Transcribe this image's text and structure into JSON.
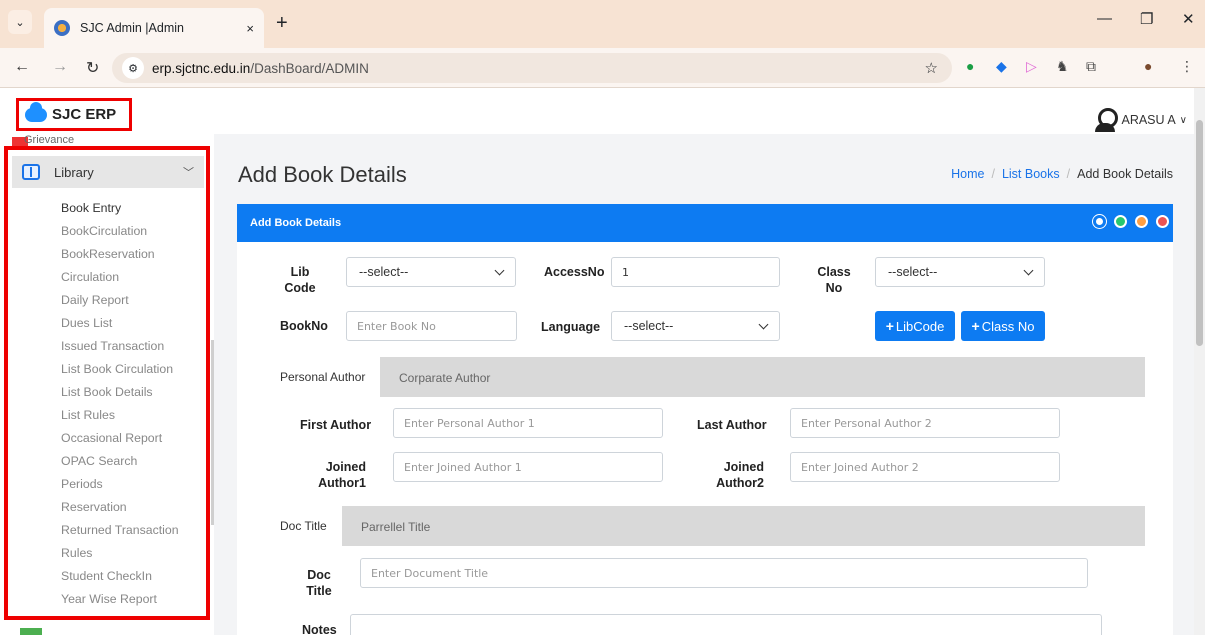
{
  "browser": {
    "tab_title": "SJC Admin |Admin",
    "tab_close": "×",
    "new_tab": "+",
    "url_host": "erp.sjctnc.edu.in",
    "url_path": "/DashBoard/ADMIN",
    "minimize": "—",
    "restore": "❐",
    "close": "✕"
  },
  "header": {
    "brand": "SJC ERP",
    "user": "ARASU A",
    "user_chevron": "∨"
  },
  "sidebar": {
    "grievance": "Grievance",
    "section": "Library",
    "items": [
      "Book Entry",
      "BookCirculation",
      "BookReservation",
      "Circulation",
      "Daily Report",
      "Dues List",
      "Issued Transaction",
      "List Book Circulation",
      "List Book Details",
      "List Rules",
      "Occasional Report",
      "OPAC Search",
      "Periods",
      "Reservation",
      "Returned Transaction",
      "Rules",
      "Student CheckIn",
      "Year Wise Report"
    ]
  },
  "page": {
    "title": "Add Book Details",
    "breadcrumb": {
      "home": "Home",
      "list": "List Books",
      "current": "Add Book Details",
      "sep": "/"
    },
    "card_title": "Add Book Details"
  },
  "form": {
    "lib_code_label1": "Lib",
    "lib_code_label2": "Code",
    "lib_code_value": "--select--",
    "access_no_label": "AccessNo",
    "access_no_value": "1",
    "class_no_label1": "Class",
    "class_no_label2": "No",
    "class_no_value": "--select--",
    "book_no_label": "BookNo",
    "book_no_placeholder": "Enter Book No",
    "language_label": "Language",
    "language_value": "--select--",
    "btn_libcode": "LibCode",
    "btn_classno": "Class No",
    "author_tabs": [
      "Personal Author",
      "Corparate Author"
    ],
    "first_author_label": "First Author",
    "first_author_placeholder": "Enter Personal Author 1",
    "last_author_label": "Last Author",
    "last_author_placeholder": "Enter Personal Author 2",
    "joined1_label1": "Joined",
    "joined1_label2": "Author1",
    "joined1_placeholder": "Enter Joined Author 1",
    "joined2_label1": "Joined",
    "joined2_label2": "Author2",
    "joined2_placeholder": "Enter Joined Author 2",
    "title_tabs": [
      "Doc Title",
      "Parrellel Title"
    ],
    "doc_title_label1": "Doc",
    "doc_title_label2": "Title",
    "doc_title_placeholder": "Enter Document Title",
    "notes_label": "Notes"
  },
  "colors": {
    "accent": "#0d7bf2",
    "highlight": "#e00000",
    "tool_colors": [
      "#fff",
      "#28c76f",
      "#ff9f43",
      "#ea5455"
    ]
  }
}
